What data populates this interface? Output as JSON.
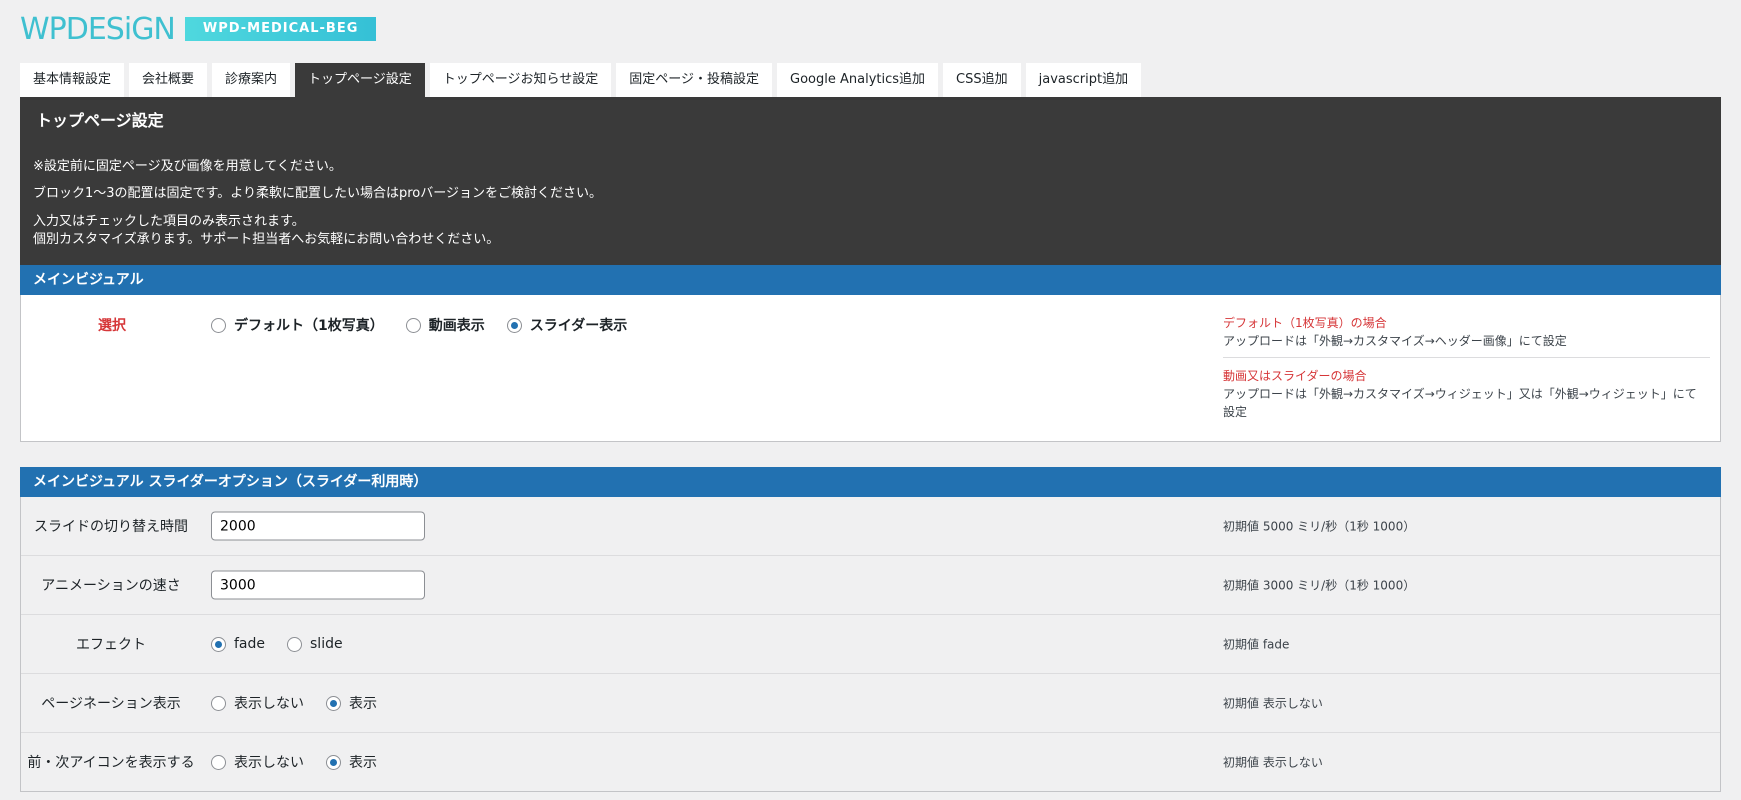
{
  "header": {
    "logo": "WPDESiGN",
    "badge": "WPD-MEDICAL-BEG"
  },
  "tabs": [
    {
      "label": "基本情報設定",
      "active": false
    },
    {
      "label": "会社概要",
      "active": false
    },
    {
      "label": "診療案内",
      "active": false
    },
    {
      "label": "トップページ設定",
      "active": true
    },
    {
      "label": "トップページお知らせ設定",
      "active": false
    },
    {
      "label": "固定ページ・投稿設定",
      "active": false
    },
    {
      "label": "Google Analytics追加",
      "active": false
    },
    {
      "label": "CSS追加",
      "active": false
    },
    {
      "label": "javascript追加",
      "active": false
    }
  ],
  "intro": {
    "title": "トップページ設定",
    "line1": "※設定前に固定ページ及び画像を用意してください。",
    "line2": "ブロック1～3の配置は固定です。より柔軟に配置したい場合はproバージョンをご検討ください。",
    "line3": "入力又はチェックした項目のみ表示されます。",
    "line4": "個別カスタマイズ承ります。サポート担当者へお気軽にお問い合わせください。"
  },
  "main_visual": {
    "heading": "メインビジュアル",
    "label": "選択",
    "options": [
      "デフォルト（1枚写真）",
      "動画表示",
      "スライダー表示"
    ],
    "selected": "スライダー表示",
    "note1_title": "デフォルト（1枚写真）の場合",
    "note1_text": "アップロードは「外観→カスタマイズ→ヘッダー画像」にて設定",
    "note2_title": "動画又はスライダーの場合",
    "note2_text1": "アップロードは「外観→カスタマイズ→ウィジェット」又は「外観→ウィジェット」にて",
    "note2_text2": "設定"
  },
  "slider_options": {
    "heading": "メインビジュアル スライダーオプション（スライダー利用時）",
    "switch_time": {
      "label": "スライドの切り替え時間",
      "value": "2000",
      "note": "初期値 5000 ミリ/秒（1秒 1000）"
    },
    "anim_speed": {
      "label": "アニメーションの速さ",
      "value": "3000",
      "note": "初期値 3000 ミリ/秒（1秒 1000）"
    },
    "effect": {
      "label": "エフェクト",
      "options": [
        "fade",
        "slide"
      ],
      "selected": "fade",
      "note": "初期値 fade"
    },
    "pagination": {
      "label": "ページネーション表示",
      "options": [
        "表示しない",
        "表示"
      ],
      "selected": "表示",
      "note": "初期値 表示しない"
    },
    "nav_icons": {
      "label": "前・次アイコンを表示する",
      "options": [
        "表示しない",
        "表示"
      ],
      "selected": "表示",
      "note": "初期値 表示しない"
    }
  },
  "colors": {
    "accent": "#2271b1",
    "dark": "#3a3a3a",
    "logo": "#3fc0d0",
    "red": "#d63638"
  }
}
